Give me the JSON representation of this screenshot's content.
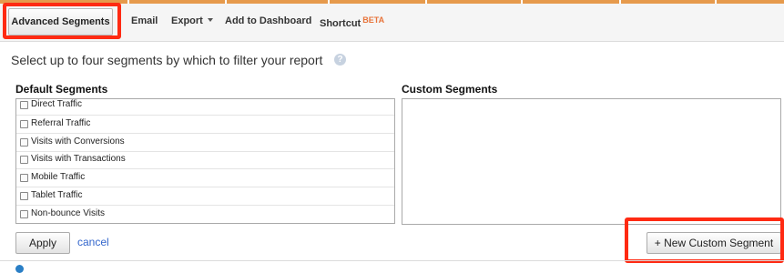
{
  "toolbar": {
    "advanced_segments": "Advanced Segments",
    "email": "Email",
    "export": "Export",
    "add_to_dashboard": "Add to Dashboard",
    "shortcut": "Shortcut",
    "beta_badge": "BETA"
  },
  "instruction": "Select up to four segments by which to filter your report",
  "help_icon_glyph": "?",
  "default_segments": {
    "title": "Default Segments",
    "items": [
      {
        "label": "Direct Traffic",
        "checked": false
      },
      {
        "label": "Referral Traffic",
        "checked": false
      },
      {
        "label": "Visits with Conversions",
        "checked": false
      },
      {
        "label": "Visits with Transactions",
        "checked": false
      },
      {
        "label": "Mobile Traffic",
        "checked": false
      },
      {
        "label": "Tablet Traffic",
        "checked": false
      },
      {
        "label": "Non-bounce Visits",
        "checked": false
      }
    ]
  },
  "custom_segments": {
    "title": "Custom Segments",
    "items": []
  },
  "actions": {
    "apply": "Apply",
    "cancel": "cancel",
    "new_custom_segment": "+ New Custom Segment"
  },
  "colors": {
    "highlight": "#ff2a12",
    "accent_strip": "#e69a4c",
    "link": "#3366cc",
    "beta": "#e8743b"
  }
}
